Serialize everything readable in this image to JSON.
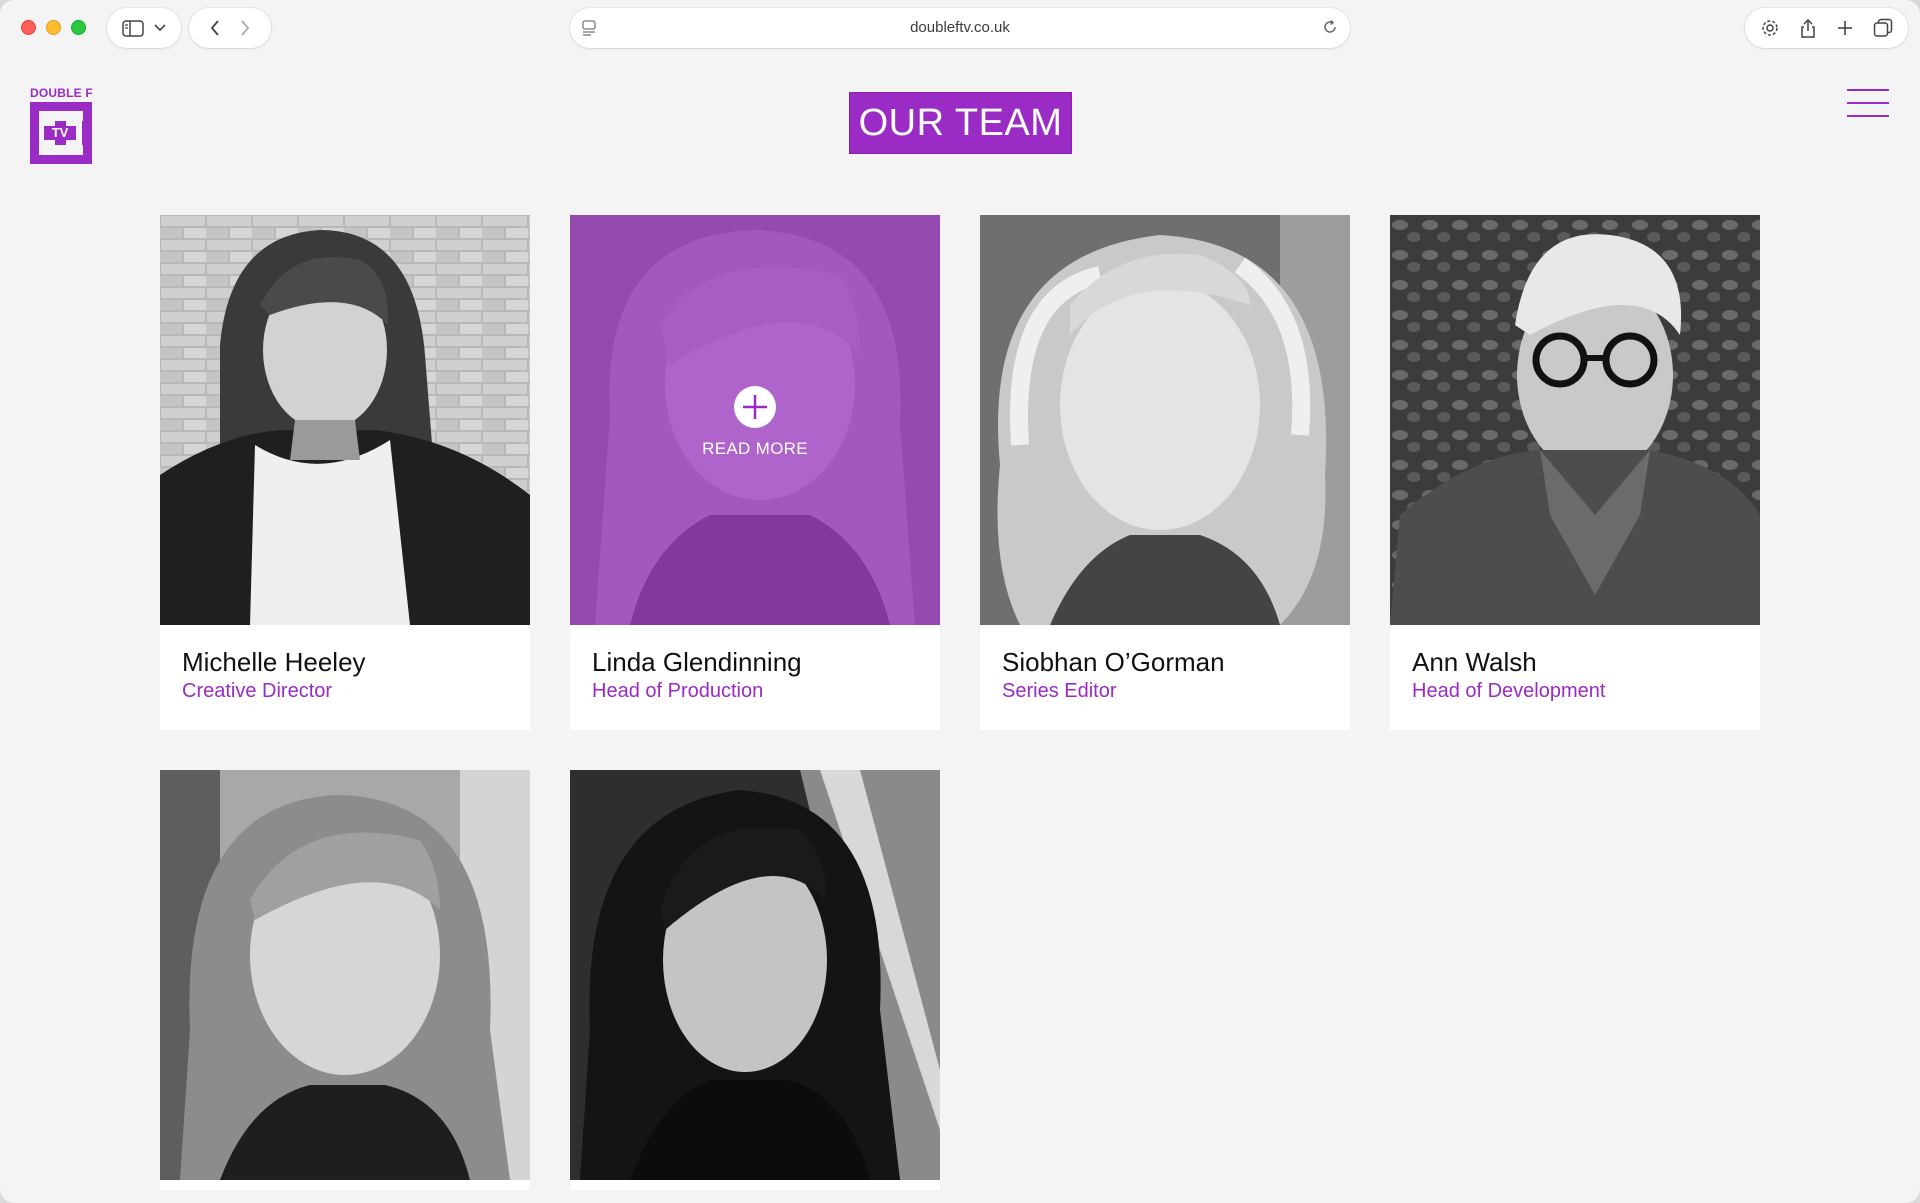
{
  "browser": {
    "url": "doubleftv.co.uk",
    "icons": [
      "sidebar-icon",
      "chevron-down-icon",
      "back-icon",
      "forward-icon",
      "page-icon",
      "reload-icon",
      "settings-icon",
      "share-icon",
      "new-tab-icon",
      "tabs-overview-icon"
    ]
  },
  "site": {
    "logo_text": "DOUBLE F",
    "logo_mark_text": "TV",
    "page_title": "OUR TEAM",
    "accent_color": "#9a2bc4"
  },
  "team": {
    "read_more_label": "READ MORE",
    "members": [
      {
        "name": "Michelle Heeley",
        "role": "Creative Director"
      },
      {
        "name": "Linda Glendinning",
        "role": "Head of Production"
      },
      {
        "name": "Siobhan O’Gorman",
        "role": "Series Editor"
      },
      {
        "name": "Ann Walsh",
        "role": "Head of Development"
      },
      {
        "name": "",
        "role": ""
      },
      {
        "name": "",
        "role": ""
      }
    ]
  }
}
